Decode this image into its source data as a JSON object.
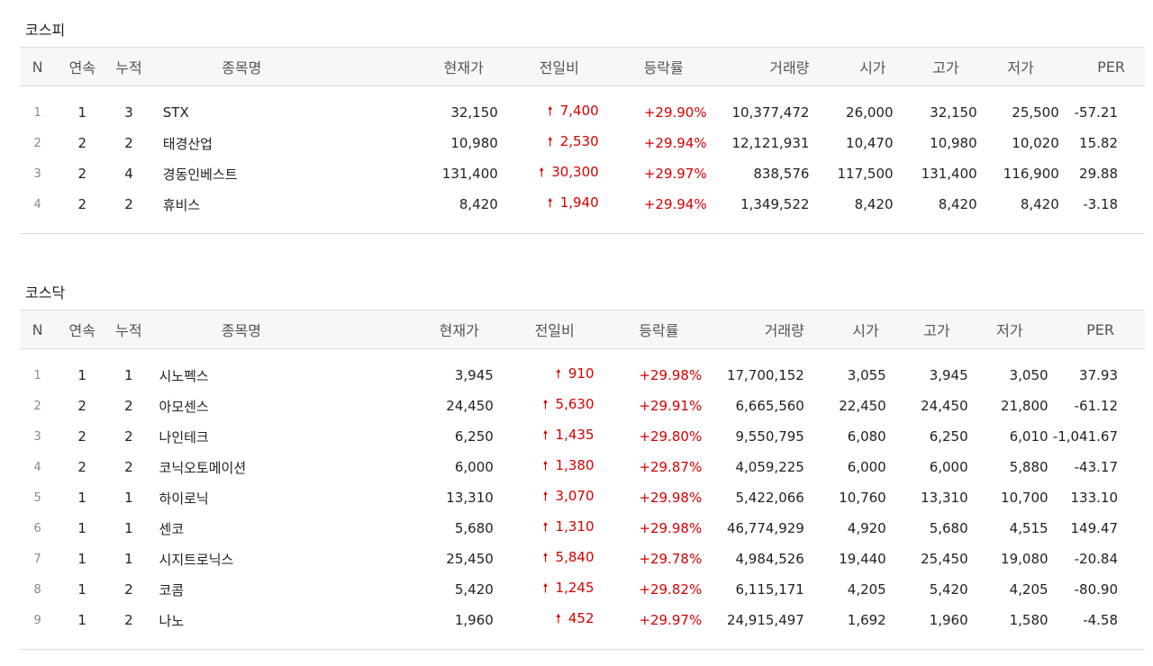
{
  "headers": [
    "N",
    "연속",
    "누적",
    "종목명",
    "현재가",
    "전일비",
    "등락률",
    "거래량",
    "시가",
    "고가",
    "저가",
    "PER"
  ],
  "sections": [
    {
      "title": "코스피",
      "rows": [
        {
          "n": "1",
          "streak": "1",
          "cumulative": "3",
          "name": "STX",
          "price": "32,150",
          "change": "7,400",
          "rate": "+29.90%",
          "volume": "10,377,472",
          "open": "26,000",
          "high": "32,150",
          "low": "25,500",
          "per": "-57.21"
        },
        {
          "n": "2",
          "streak": "2",
          "cumulative": "2",
          "name": "태경산업",
          "price": "10,980",
          "change": "2,530",
          "rate": "+29.94%",
          "volume": "12,121,931",
          "open": "10,470",
          "high": "10,980",
          "low": "10,020",
          "per": "15.82"
        },
        {
          "n": "3",
          "streak": "2",
          "cumulative": "4",
          "name": "경동인베스트",
          "price": "131,400",
          "change": "30,300",
          "rate": "+29.97%",
          "volume": "838,576",
          "open": "117,500",
          "high": "131,400",
          "low": "116,900",
          "per": "29.88"
        },
        {
          "n": "4",
          "streak": "2",
          "cumulative": "2",
          "name": "휴비스",
          "price": "8,420",
          "change": "1,940",
          "rate": "+29.94%",
          "volume": "1,349,522",
          "open": "8,420",
          "high": "8,420",
          "low": "8,420",
          "per": "-3.18"
        }
      ]
    },
    {
      "title": "코스닥",
      "rows": [
        {
          "n": "1",
          "streak": "1",
          "cumulative": "1",
          "name": "시노펙스",
          "price": "3,945",
          "change": "910",
          "rate": "+29.98%",
          "volume": "17,700,152",
          "open": "3,055",
          "high": "3,945",
          "low": "3,050",
          "per": "37.93"
        },
        {
          "n": "2",
          "streak": "2",
          "cumulative": "2",
          "name": "아모센스",
          "price": "24,450",
          "change": "5,630",
          "rate": "+29.91%",
          "volume": "6,665,560",
          "open": "22,450",
          "high": "24,450",
          "low": "21,800",
          "per": "-61.12"
        },
        {
          "n": "3",
          "streak": "2",
          "cumulative": "2",
          "name": "나인테크",
          "price": "6,250",
          "change": "1,435",
          "rate": "+29.80%",
          "volume": "9,550,795",
          "open": "6,080",
          "high": "6,250",
          "low": "6,010",
          "per": "-1,041.67"
        },
        {
          "n": "4",
          "streak": "2",
          "cumulative": "2",
          "name": "코닉오토메이션",
          "price": "6,000",
          "change": "1,380",
          "rate": "+29.87%",
          "volume": "4,059,225",
          "open": "6,000",
          "high": "6,000",
          "low": "5,880",
          "per": "-43.17"
        },
        {
          "n": "5",
          "streak": "1",
          "cumulative": "1",
          "name": "하이로닉",
          "price": "13,310",
          "change": "3,070",
          "rate": "+29.98%",
          "volume": "5,422,066",
          "open": "10,760",
          "high": "13,310",
          "low": "10,700",
          "per": "133.10"
        },
        {
          "n": "6",
          "streak": "1",
          "cumulative": "1",
          "name": "센코",
          "price": "5,680",
          "change": "1,310",
          "rate": "+29.98%",
          "volume": "46,774,929",
          "open": "4,920",
          "high": "5,680",
          "low": "4,515",
          "per": "149.47"
        },
        {
          "n": "7",
          "streak": "1",
          "cumulative": "1",
          "name": "시지트로닉스",
          "price": "25,450",
          "change": "5,840",
          "rate": "+29.78%",
          "volume": "4,984,526",
          "open": "19,440",
          "high": "25,450",
          "low": "19,080",
          "per": "-20.84"
        },
        {
          "n": "8",
          "streak": "1",
          "cumulative": "2",
          "name": "코콤",
          "price": "5,420",
          "change": "1,245",
          "rate": "+29.82%",
          "volume": "6,115,171",
          "open": "4,205",
          "high": "5,420",
          "low": "4,205",
          "per": "-80.90"
        },
        {
          "n": "9",
          "streak": "1",
          "cumulative": "2",
          "name": "나노",
          "price": "1,960",
          "change": "452",
          "rate": "+29.97%",
          "volume": "24,915,497",
          "open": "1,692",
          "high": "1,960",
          "low": "1,580",
          "per": "-4.58"
        }
      ]
    }
  ],
  "colors": {
    "up": "#d40000",
    "header_bg": "#f7f7f7",
    "border": "#dcdcdc"
  },
  "icons": {
    "change_direction": "up-arrow-icon"
  }
}
